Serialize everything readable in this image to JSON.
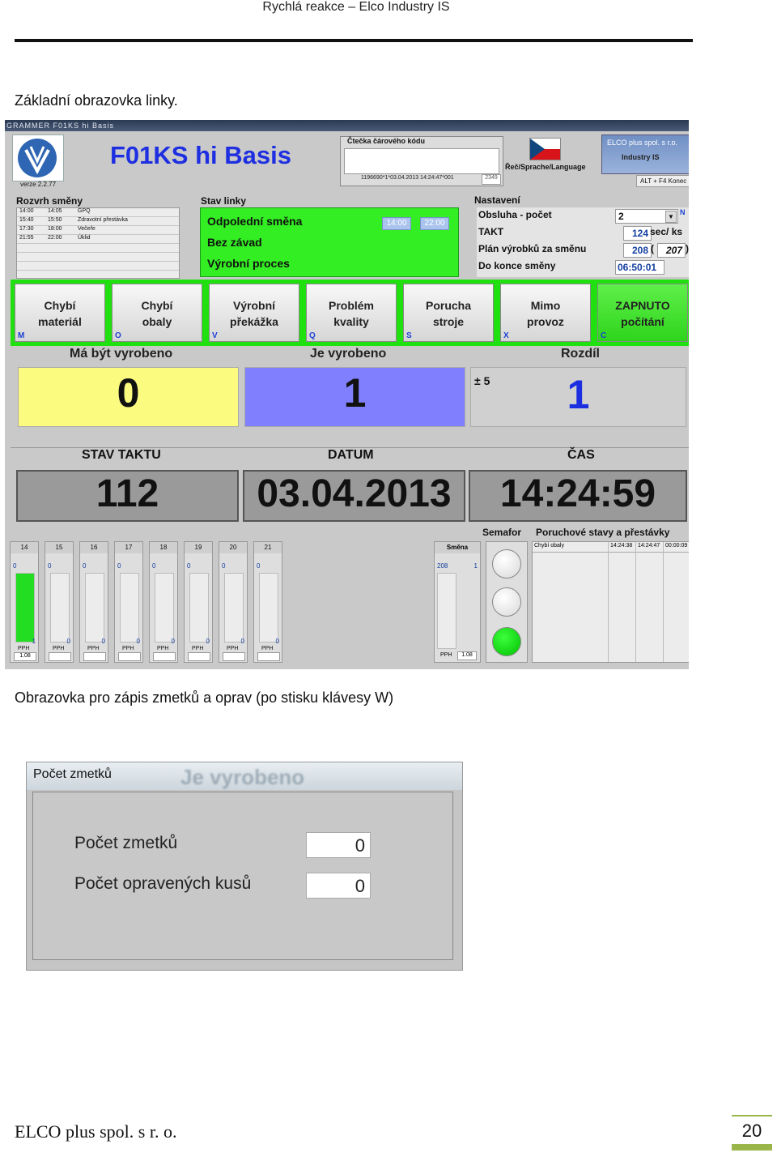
{
  "doc": {
    "header": "Rychlá reakce – Elco Industry IS",
    "caption1": "Základní obrazovka linky.",
    "caption2": "Obrazovka pro zápis zmetků a oprav (po stisku klávesy W)",
    "footer": "ELCO plus spol. s r. o.",
    "page_number": "20"
  },
  "screen1": {
    "window_title": "GRAMMER   F01KS hi Basis",
    "version": "verze 2.2.77",
    "line_name": "F01KS hi Basis",
    "barcode_label": "Čtečka čárového kódu",
    "barcode_value": "1196690*1*03.04.2013 14:24:47*001",
    "barcode_num": "2349",
    "language_label": "Řeč/Sprache/Language",
    "elco_line1": "ELCO plus spol. s r.o.",
    "elco_line2": "Industry IS",
    "alt_label": "ALT + F4  Konec",
    "schedule": {
      "label": "Rozvrh směny",
      "rows": [
        {
          "from": "14:00",
          "to": "14:05",
          "name": "GPQ"
        },
        {
          "from": "15:40",
          "to": "15:50",
          "name": "Zdravotní přestávka"
        },
        {
          "from": "17:30",
          "to": "18:00",
          "name": "Večeře"
        },
        {
          "from": "21:55",
          "to": "22:00",
          "name": "Úklid"
        }
      ]
    },
    "status": {
      "label": "Stav linky",
      "line1": "Odpolední směna",
      "line2": "Bez závad",
      "line3": "Výrobní proces",
      "time_from": "14:00",
      "time_to": "22:00"
    },
    "settings": {
      "label": "Nastavení",
      "obsluha_label": "Obsluha - počet",
      "obsluha_value": "2",
      "takt_label": "TAKT",
      "takt_value": "124",
      "takt_unit": "sec/ ks",
      "plan_label": "Plán výrobků za směnu",
      "plan_value": "208",
      "plan_value2": "207",
      "remaining_label": "Do konce směny",
      "remaining_value": "06:50:01",
      "flag_n": "N"
    },
    "buttons": [
      {
        "label1": "Chybí",
        "label2": "materiál",
        "key": "M"
      },
      {
        "label1": "Chybí",
        "label2": "obaly",
        "key": "O"
      },
      {
        "label1": "Výrobní",
        "label2": "překážka",
        "key": "V"
      },
      {
        "label1": "Problém",
        "label2": "kvality",
        "key": "Q"
      },
      {
        "label1": "Porucha",
        "label2": "stroje",
        "key": "S"
      },
      {
        "label1": "Mimo",
        "label2": "provoz",
        "key": "X"
      },
      {
        "label1": "ZAPNUTO",
        "label2": "počítání",
        "key": "C"
      }
    ],
    "counts": {
      "should_label": "Má být vyrobeno",
      "should_value": "0",
      "done_label": "Je vyrobeno",
      "done_value": "1",
      "diff_label": "Rozdíl",
      "diff_tolerance": "± 5",
      "diff_value": "1"
    },
    "bigs": {
      "takt_label": "STAV TAKTU",
      "takt_value": "112",
      "date_label": "DATUM",
      "date_value": "03.04.2013",
      "time_label": "ČAS",
      "time_value": "14:24:59"
    },
    "hours": [
      {
        "hour": "14",
        "top": "0",
        "bottom": "1",
        "pph": "PPH",
        "pph_value": "1.08",
        "fill": 1.0
      },
      {
        "hour": "15",
        "top": "0",
        "bottom": "0",
        "pph": "PPH",
        "pph_value": "",
        "fill": 0
      },
      {
        "hour": "16",
        "top": "0",
        "bottom": "0",
        "pph": "PPH",
        "pph_value": "",
        "fill": 0
      },
      {
        "hour": "17",
        "top": "0",
        "bottom": "0",
        "pph": "PPH",
        "pph_value": "",
        "fill": 0
      },
      {
        "hour": "18",
        "top": "0",
        "bottom": "0",
        "pph": "PPH",
        "pph_value": "",
        "fill": 0
      },
      {
        "hour": "19",
        "top": "0",
        "bottom": "0",
        "pph": "PPH",
        "pph_value": "",
        "fill": 0
      },
      {
        "hour": "20",
        "top": "0",
        "bottom": "0",
        "pph": "PPH",
        "pph_value": "",
        "fill": 0
      },
      {
        "hour": "21",
        "top": "0",
        "bottom": "0",
        "pph": "PPH",
        "pph_value": "",
        "fill": 0
      }
    ],
    "smena": {
      "label": "Směna",
      "top": "208",
      "bottom": "1",
      "pph": "PPH",
      "pph_value": "1.08"
    },
    "semafor_label": "Semafor",
    "faults": {
      "label": "Poruchové stavy a přestávky",
      "row_name": "Chybí obaly",
      "row_from": "14:24:38",
      "row_to": "14:24:47",
      "row_dur": "00:00:09"
    }
  },
  "screen2": {
    "title": "Počet zmetků",
    "ghost_text": "Je vyrobeno",
    "scrap_label": "Počet zmetků",
    "scrap_value": "0",
    "repaired_label": "Počet opravených kusů",
    "repaired_value": "0"
  }
}
